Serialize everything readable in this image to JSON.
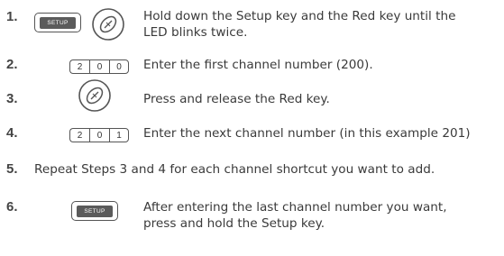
{
  "steps": [
    {
      "number": "1.",
      "text_line1": "Hold down the Setup key and the Red key until the",
      "text_line2": "LED blinks twice."
    },
    {
      "number": "2.",
      "digits": [
        "2",
        "0",
        "0"
      ],
      "text": "Enter the first channel number (200)."
    },
    {
      "number": "3.",
      "text": "Press and release the Red key."
    },
    {
      "number": "4.",
      "digits": [
        "2",
        "0",
        "1"
      ],
      "text": "Enter the next channel number (in this example 201)"
    },
    {
      "number": "5.",
      "text": "Repeat Steps 3 and 4 for each channel shortcut you want to add."
    },
    {
      "number": "6.",
      "text_line1": "After entering the last channel number you want,",
      "text_line2": "press and hold the Setup key."
    }
  ],
  "keys": {
    "setup_label": "SETUP"
  },
  "icons": {
    "red_key": "red-key-icon"
  }
}
